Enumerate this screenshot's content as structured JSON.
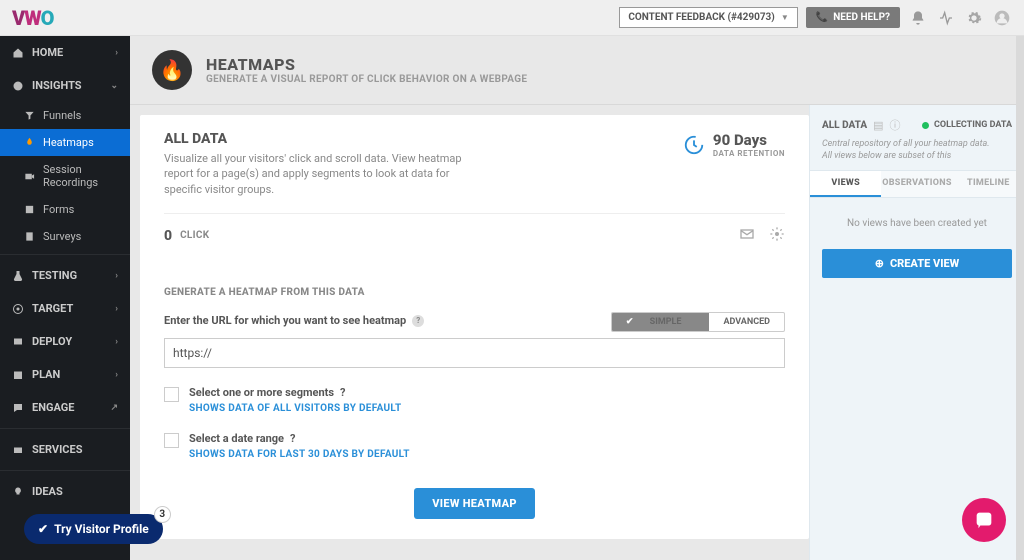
{
  "topbar": {
    "feedback": "CONTENT FEEDBACK (#429073)",
    "help": "NEED HELP?"
  },
  "sidebar": {
    "home": "HOME",
    "insights": "INSIGHTS",
    "subs": [
      "Funnels",
      "Heatmaps",
      "Session Recordings",
      "Forms",
      "Surveys"
    ],
    "rest": [
      "TESTING",
      "TARGET",
      "DEPLOY",
      "PLAN",
      "ENGAGE",
      "SERVICES",
      "IDEAS"
    ]
  },
  "page": {
    "title": "HEATMAPS",
    "subtitle": "GENERATE A VISUAL REPORT OF CLICK BEHAVIOR ON A WEBPAGE"
  },
  "alldata": {
    "title": "ALL DATA",
    "desc": "Visualize all your visitors' click and scroll data. View heatmap report for a page(s) and apply segments to look at data for specific visitor groups.",
    "retention_value": "90 Days",
    "retention_label": "DATA RETENTION",
    "count": "0",
    "count_label": "CLICK"
  },
  "generate": {
    "heading": "GENERATE A HEATMAP FROM THIS DATA",
    "url_label": "Enter the URL for which you want to see heatmap",
    "mode_simple": "SIMPLE",
    "mode_advanced": "ADVANCED",
    "url_value": "https://",
    "seg_label": "Select one or more segments",
    "seg_hint": "SHOWS DATA OF ALL VISITORS BY DEFAULT",
    "date_label": "Select a date range",
    "date_hint": "SHOWS DATA FOR LAST 30 DAYS BY DEFAULT",
    "cta": "VIEW HEATMAP"
  },
  "rightpanel": {
    "title": "ALL DATA",
    "status": "COLLECTING DATA",
    "desc1": "Central repository of all your heatmap data.",
    "desc2": "All views below are subset of this",
    "tabs": [
      "VIEWS",
      "OBSERVATIONS",
      "TIMELINE"
    ],
    "empty": "No views have been created yet",
    "create": "CREATE VIEW"
  },
  "bubble": {
    "text": "Try Visitor Profile",
    "badge": "3"
  }
}
